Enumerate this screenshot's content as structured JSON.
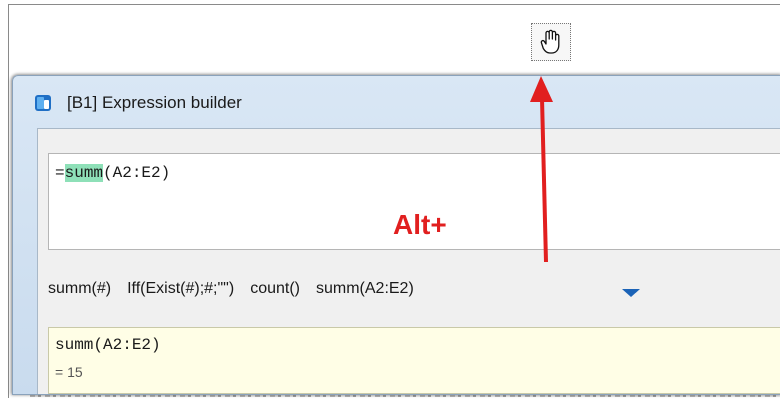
{
  "dialog": {
    "title": "[B1] Expression builder"
  },
  "editor": {
    "prefix": "=",
    "highlighted": "summ",
    "rest": "(A2:E2)"
  },
  "hint": {
    "text": "Alt+"
  },
  "shortcuts": [
    "summ(#)",
    "Iff(Exist(#);#;\"\")",
    "count()",
    "summ(A2:E2)"
  ],
  "result": {
    "expression": "summ(A2:E2)",
    "value": "= 15"
  },
  "icons": {
    "drag_target": "hand-cursor-icon",
    "app": "expression-builder-app-icon",
    "more": "dropdown-triangle-icon"
  },
  "colors": {
    "highlight": "#8ee0b8",
    "hint": "#e11f1f",
    "arrow": "#e11f1f",
    "result_bg": "#fffee6",
    "dropdown": "#1b63b7"
  }
}
